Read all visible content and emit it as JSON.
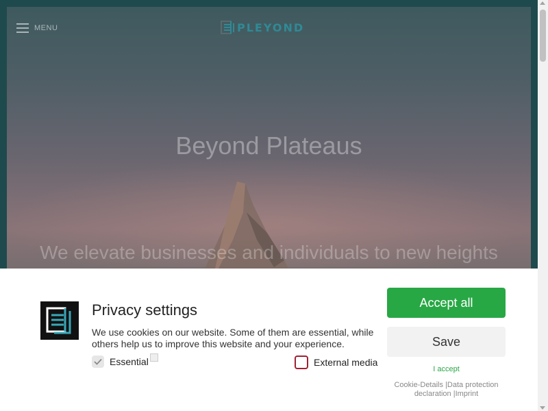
{
  "header": {
    "menu_label": "MENU",
    "logo_text": "PLEYOND"
  },
  "hero": {
    "title": "Beyond Plateaus",
    "subtitle": "We elevate businesses and individuals to new heights"
  },
  "cookie_banner": {
    "title": "Privacy settings",
    "text": "We use cookies on our website. Some of them are essential, while others help us to improve this website and your experience.",
    "option_essential": "Essential",
    "option_external": "External media",
    "accept_all_label": "Accept all",
    "save_label": "Save",
    "i_accept_label": "I accept",
    "link_cookie_details": "Cookie-Details",
    "link_data_protection": "Data protection declaration",
    "link_imprint": "Imprint",
    "separator": "|"
  },
  "colors": {
    "accept_green": "#28a745",
    "logo_teal": "#2f8a96",
    "external_checkbox_border": "#a02030"
  }
}
